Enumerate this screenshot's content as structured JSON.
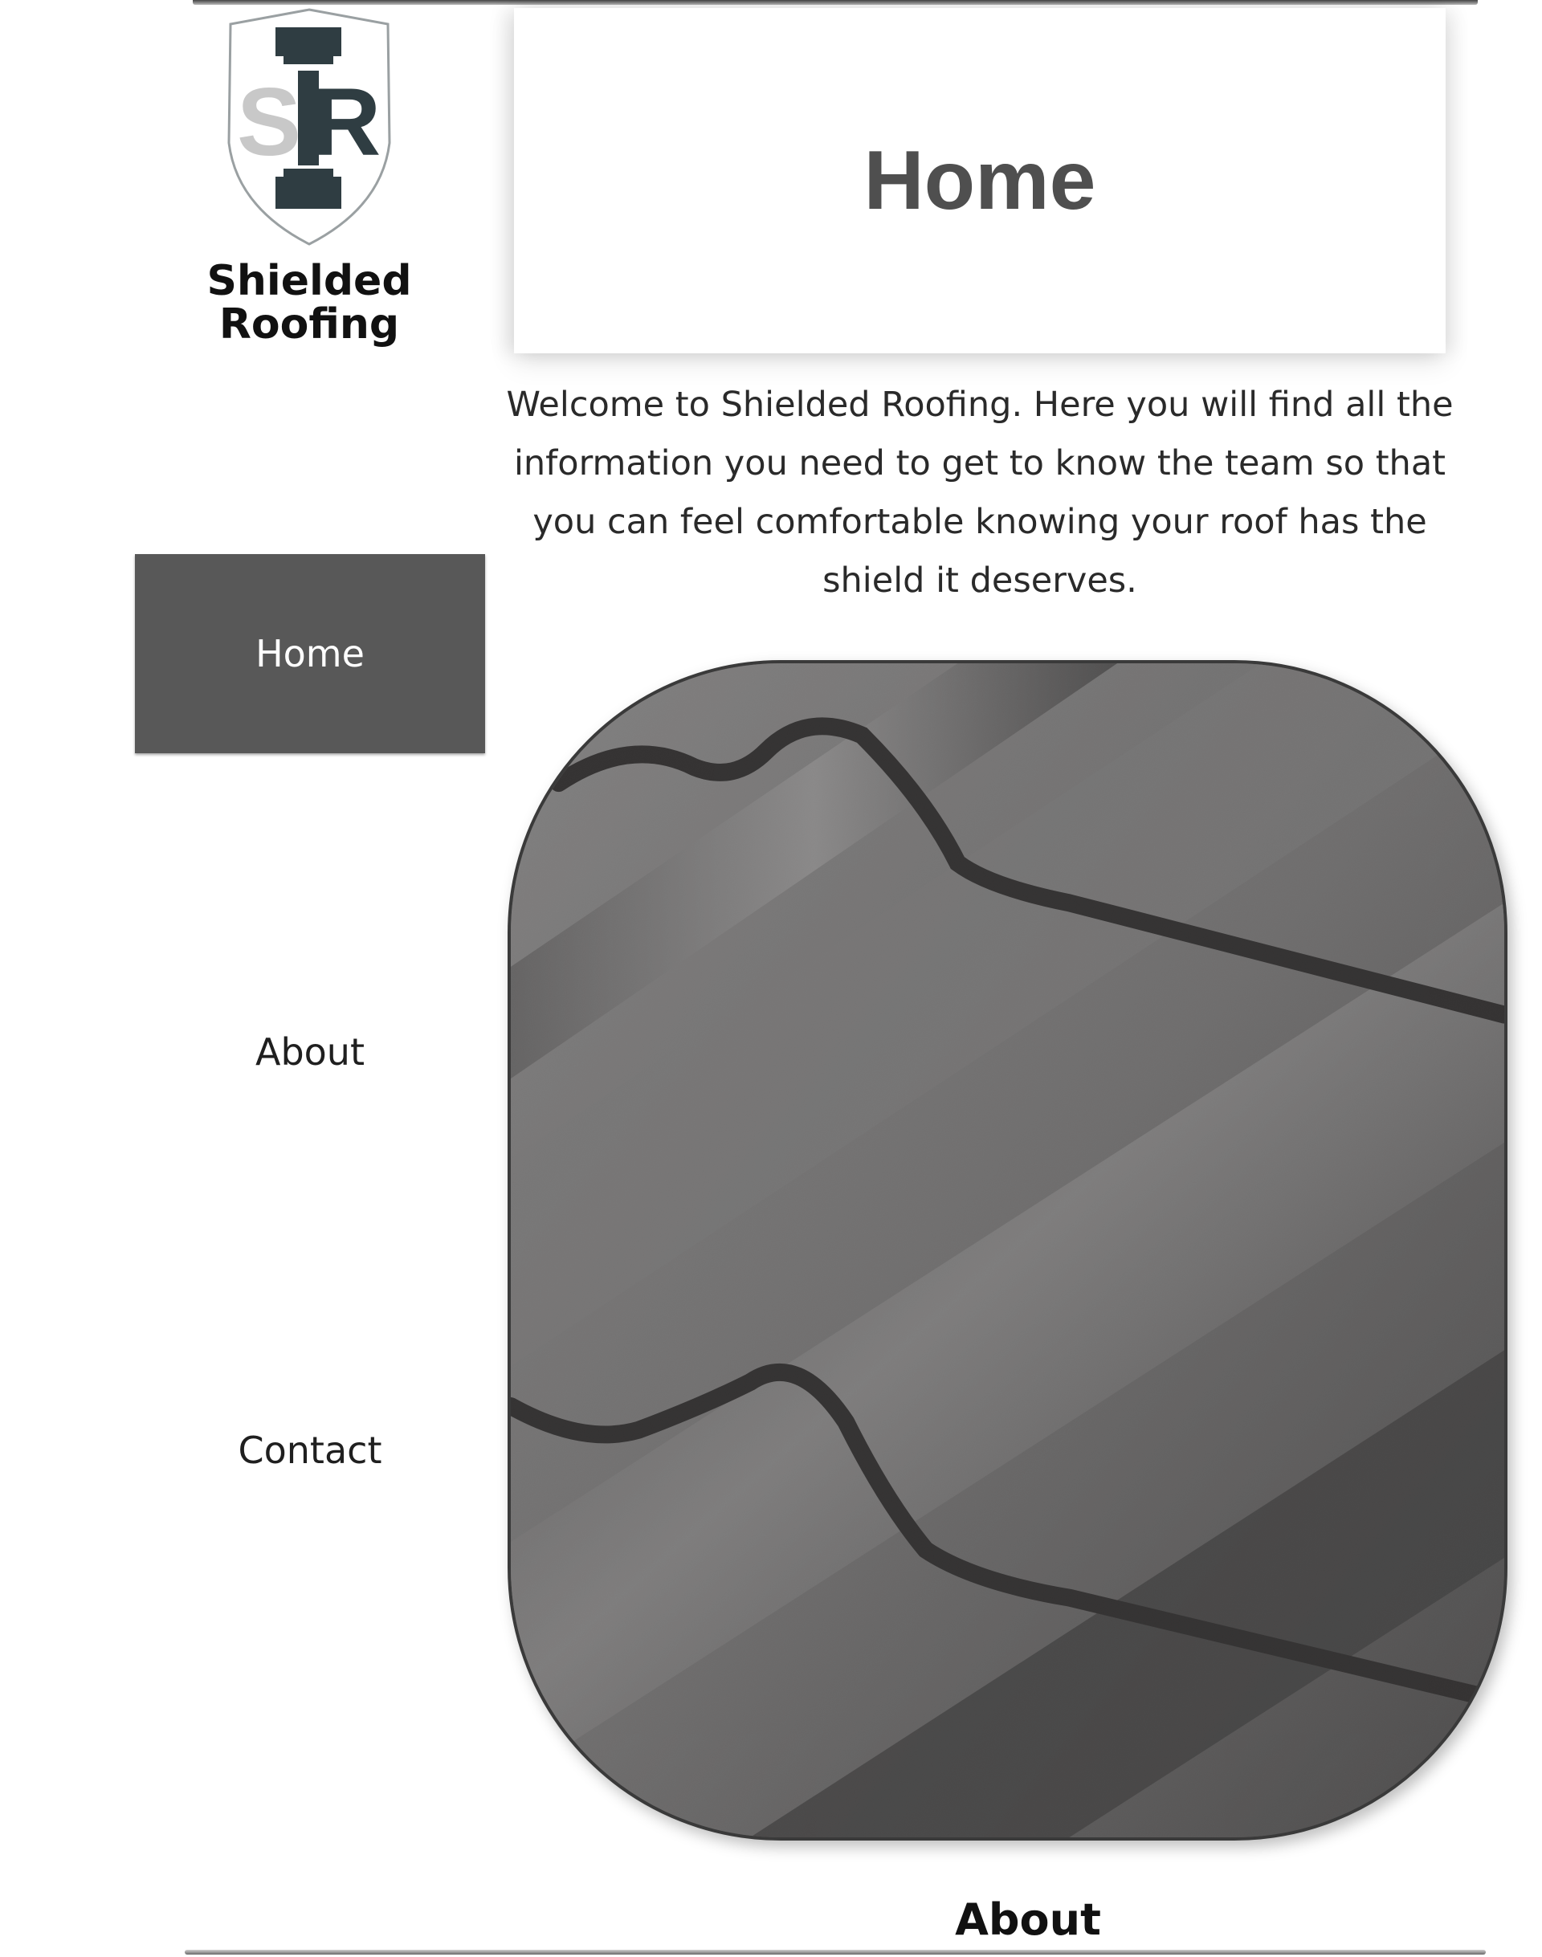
{
  "brand": {
    "logo_letters_left": "S",
    "logo_letters_right": "R",
    "name_line1": "Shielded",
    "name_line2": "Roofing"
  },
  "nav": {
    "items": [
      {
        "label": "Home",
        "active": true
      },
      {
        "label": "About",
        "active": false
      },
      {
        "label": "Contact",
        "active": false
      }
    ]
  },
  "main": {
    "title": "Home",
    "welcome": "Welcome to Shielded Roofing. Here you will find all the information you need to get to know the team so that you can feel comfortable knowing your roof has the shield it deserves.",
    "hero_image": "metal-roof-tiles-photo"
  },
  "next_section": {
    "heading": "About"
  },
  "colors": {
    "nav_active_bg": "#585858",
    "title_text": "#4f4f4f",
    "logo_dark": "#2f3d42",
    "logo_light": "#c8c8c8"
  }
}
